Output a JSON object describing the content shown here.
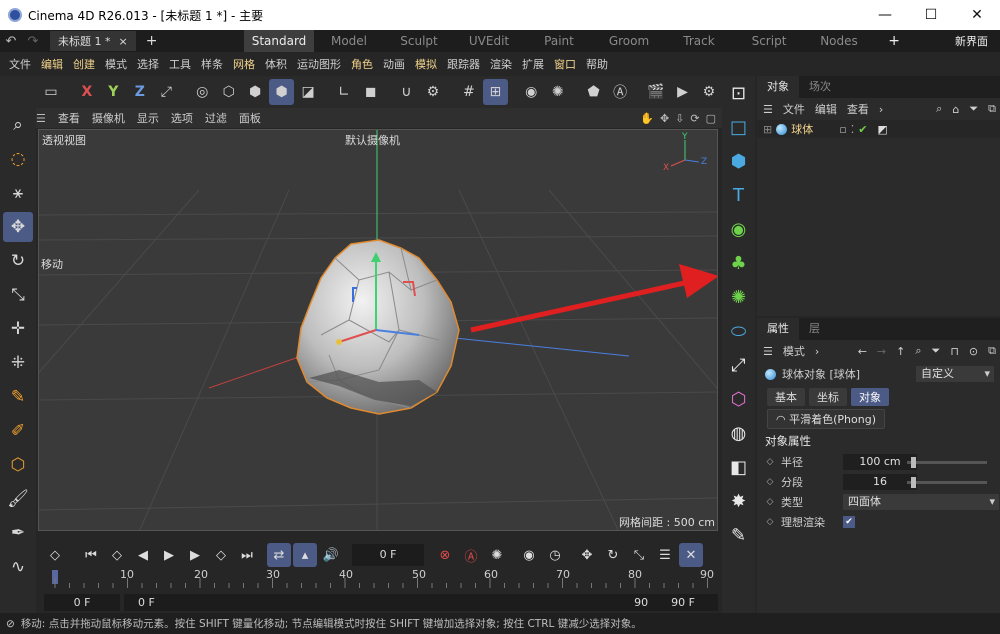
{
  "window": {
    "title": "Cinema 4D R26.013 - [未标题 1 *] - 主要",
    "minimize": "—",
    "maximize": "☐",
    "close": "✕"
  },
  "layoutbar": {
    "doc_tab": "未标题 1 *",
    "doc_close": "×",
    "plus": "+",
    "layouts": [
      "Standard",
      "Model",
      "Sculpt",
      "UVEdit",
      "Paint",
      "Groom",
      "Track",
      "Script",
      "Nodes"
    ],
    "active_layout": "Standard",
    "new_ui": "新界面"
  },
  "menu": {
    "items": [
      "文件",
      "编辑",
      "创建",
      "模式",
      "选择",
      "工具",
      "样条",
      "网格",
      "体积",
      "运动图形",
      "角色",
      "动画",
      "模拟",
      "跟踪器",
      "渲染",
      "扩展",
      "窗口",
      "帮助"
    ],
    "highlighted": [
      "编辑",
      "创建",
      "网格",
      "角色",
      "模拟",
      "窗口"
    ]
  },
  "toolbar": {
    "axes": [
      "X",
      "Y",
      "Z"
    ]
  },
  "viewport": {
    "menu": [
      "查看",
      "摄像机",
      "显示",
      "选项",
      "过滤",
      "面板"
    ],
    "view_name": "透视视图",
    "camera": "默认摄像机",
    "tool_label": "移动",
    "grid_distance": "网格间距 : 500 cm",
    "axis_y": "Y",
    "axis_x": "X",
    "axis_z": "Z"
  },
  "timeline": {
    "current_frame": "0 F",
    "ruler": [
      "0",
      "10",
      "20",
      "30",
      "40",
      "50",
      "60",
      "70",
      "80",
      "90"
    ],
    "start": "0 F",
    "range_start": "0 F",
    "range_end": "90 F",
    "end": "90 F"
  },
  "status": {
    "text": "移动: 点击并拖动鼠标移动元素。按住 SHIFT 键量化移动; 节点编辑模式时按住 SHIFT 键增加选择对象; 按住 CTRL 键减少选择对象。"
  },
  "object_manager": {
    "tabs": [
      "对象",
      "场次"
    ],
    "menu": [
      "文件",
      "编辑",
      "查看"
    ],
    "objects": [
      {
        "name": "球体"
      }
    ]
  },
  "attributes": {
    "tabs": [
      "属性",
      "层"
    ],
    "mode": "模式",
    "object_title": "球体对象 [球体]",
    "preset": "自定义",
    "subtabs": [
      "基本",
      "坐标",
      "对象"
    ],
    "active_subtab": "对象",
    "phong": "平滑着色(Phong)",
    "section": "对象属性",
    "props": [
      {
        "label": "半径",
        "value": "100 cm",
        "slider": 0.05
      },
      {
        "label": "分段",
        "value": "16",
        "slider": 0.05
      },
      {
        "label": "类型",
        "value": "四面体"
      },
      {
        "label": "理想渲染",
        "checked": true
      }
    ]
  },
  "colors": {
    "accent": "#4c5a86",
    "selection_outline": "#e08a30",
    "arrow": "#e02020",
    "x_axis": "#e05050",
    "y_axis": "#3fd070",
    "z_axis": "#4a7fe0"
  }
}
